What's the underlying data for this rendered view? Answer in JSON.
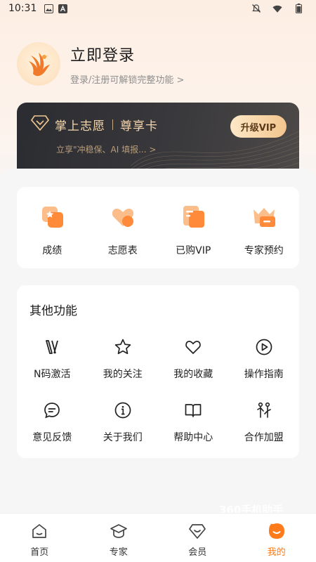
{
  "status_bar": {
    "time": "10:31"
  },
  "profile": {
    "title": "立即登录",
    "subtitle": "登录/注册可解锁完整功能 >"
  },
  "vip_card": {
    "name": "掌上志愿",
    "card_type": "尊享卡",
    "subtitle": "立享\"冲稳保、AI 填报... >",
    "button_label": "升级VIP"
  },
  "quick_actions": [
    {
      "label": "成绩",
      "icon": "score-icon"
    },
    {
      "label": "志愿表",
      "icon": "wish-list-icon"
    },
    {
      "label": "已购VIP",
      "icon": "purchased-vip-icon"
    },
    {
      "label": "专家预约",
      "icon": "expert-booking-icon"
    }
  ],
  "other_functions": {
    "title": "其他功能",
    "items": [
      {
        "label": "N码激活",
        "icon": "n-code-icon"
      },
      {
        "label": "我的关注",
        "icon": "star-icon"
      },
      {
        "label": "我的收藏",
        "icon": "heart-icon"
      },
      {
        "label": "操作指南",
        "icon": "play-icon"
      },
      {
        "label": "意见反馈",
        "icon": "feedback-icon"
      },
      {
        "label": "关于我们",
        "icon": "info-icon"
      },
      {
        "label": "帮助中心",
        "icon": "book-icon"
      },
      {
        "label": "合作加盟",
        "icon": "partnership-icon"
      }
    ]
  },
  "watermark": "360手机助手",
  "tabbar": [
    {
      "label": "首页",
      "icon": "home-icon",
      "active": false
    },
    {
      "label": "专家",
      "icon": "expert-icon",
      "active": false
    },
    {
      "label": "会员",
      "icon": "vip-icon",
      "active": false
    },
    {
      "label": "我的",
      "icon": "me-icon",
      "active": true
    }
  ],
  "colors": {
    "accent": "#ff7a1a",
    "gold": "#f4d6ae"
  }
}
